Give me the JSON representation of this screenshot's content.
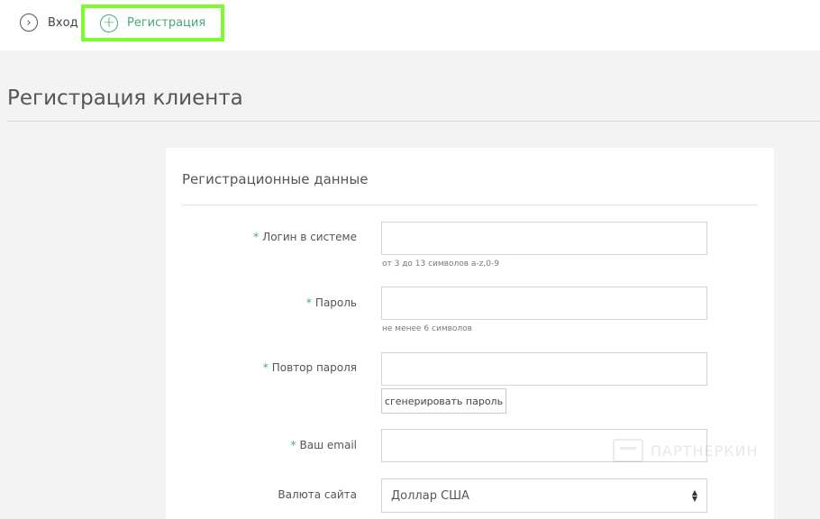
{
  "nav": {
    "login_icon": "chevron-right-circle-icon",
    "login_label": "Вход",
    "register_icon": "plus-circle-icon",
    "register_label": "Регистрация",
    "highlight_color": "#7cfc2e",
    "accent_color": "#49a878"
  },
  "page": {
    "title": "Регистрация клиента"
  },
  "form": {
    "section_title": "Регистрационные данные",
    "required_mark": "*",
    "fields": [
      {
        "label": "Логин в системе",
        "required": true,
        "value": "",
        "hint": "от 3 до 13 символов a-z,0-9"
      },
      {
        "label": "Пароль",
        "required": true,
        "value": "",
        "hint": "не менее 6 символов"
      },
      {
        "label": "Повтор пароля",
        "required": true,
        "value": "",
        "hint": ""
      },
      {
        "label": "Ваш email",
        "required": true,
        "value": "",
        "hint": ""
      }
    ],
    "generate_password_label": "сгенерировать пароль",
    "currency": {
      "label": "Валюта сайта",
      "selected": "Доллар США"
    }
  },
  "watermark": {
    "text": "ПАРТНЕРКИН"
  }
}
